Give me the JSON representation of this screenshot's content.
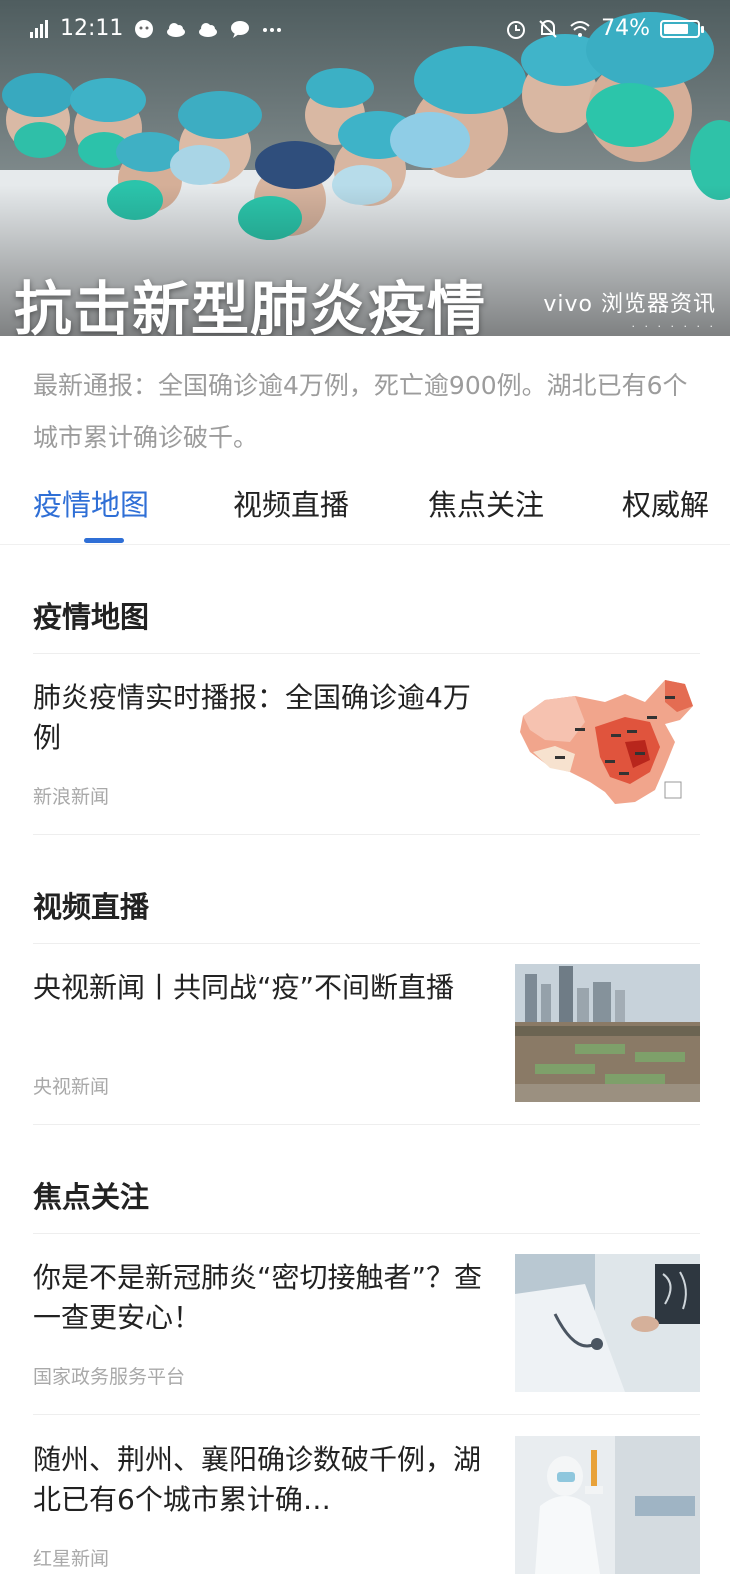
{
  "status_bar": {
    "time": "12:11",
    "battery": "74%",
    "battery_level": 0.74,
    "left_icons": [
      "signal-icon",
      "wechat-icon",
      "cloud-icon",
      "cloud-icon",
      "chat-icon",
      "more-dots-icon"
    ],
    "right_icons": [
      "alarm-icon",
      "mute-icon",
      "wifi-icon",
      "battery-icon"
    ]
  },
  "banner": {
    "title": "抗击新型肺炎疫情",
    "brand": "vivo 浏览器资讯"
  },
  "summary": "最新通报：全国确诊逾4万例，死亡逾900例。湖北已有6个城市累计确诊破千。",
  "tabs": [
    {
      "label": "疫情地图",
      "active": true
    },
    {
      "label": "视频直播",
      "active": false
    },
    {
      "label": "焦点关注",
      "active": false
    },
    {
      "label": "权威解",
      "active": false
    }
  ],
  "sections": [
    {
      "title": "疫情地图",
      "items": [
        {
          "title": "肺炎疫情实时播报：全国确诊逾4万例",
          "source": "新浪新闻",
          "thumb": "china-map-thumbnail"
        }
      ]
    },
    {
      "title": "视频直播",
      "items": [
        {
          "title": "央视新闻丨共同战“疫”不间断直播",
          "source": "央视新闻",
          "thumb": "construction-site-thumbnail"
        }
      ]
    },
    {
      "title": "焦点关注",
      "items": [
        {
          "title": "你是不是新冠肺炎“密切接触者”？查一查更安心！",
          "source": "国家政务服务平台",
          "thumb": "doctor-xray-thumbnail"
        },
        {
          "title": "随州、荆州、襄阳确诊数破千例，湖北已有6个城市累计确…",
          "source": "红星新闻",
          "thumb": "medical-worker-thumbnail"
        }
      ]
    }
  ],
  "colors": {
    "accent": "#2f6fd6",
    "text": "#222222",
    "muted": "#a9a9a9",
    "summary": "#9c9c9c"
  }
}
